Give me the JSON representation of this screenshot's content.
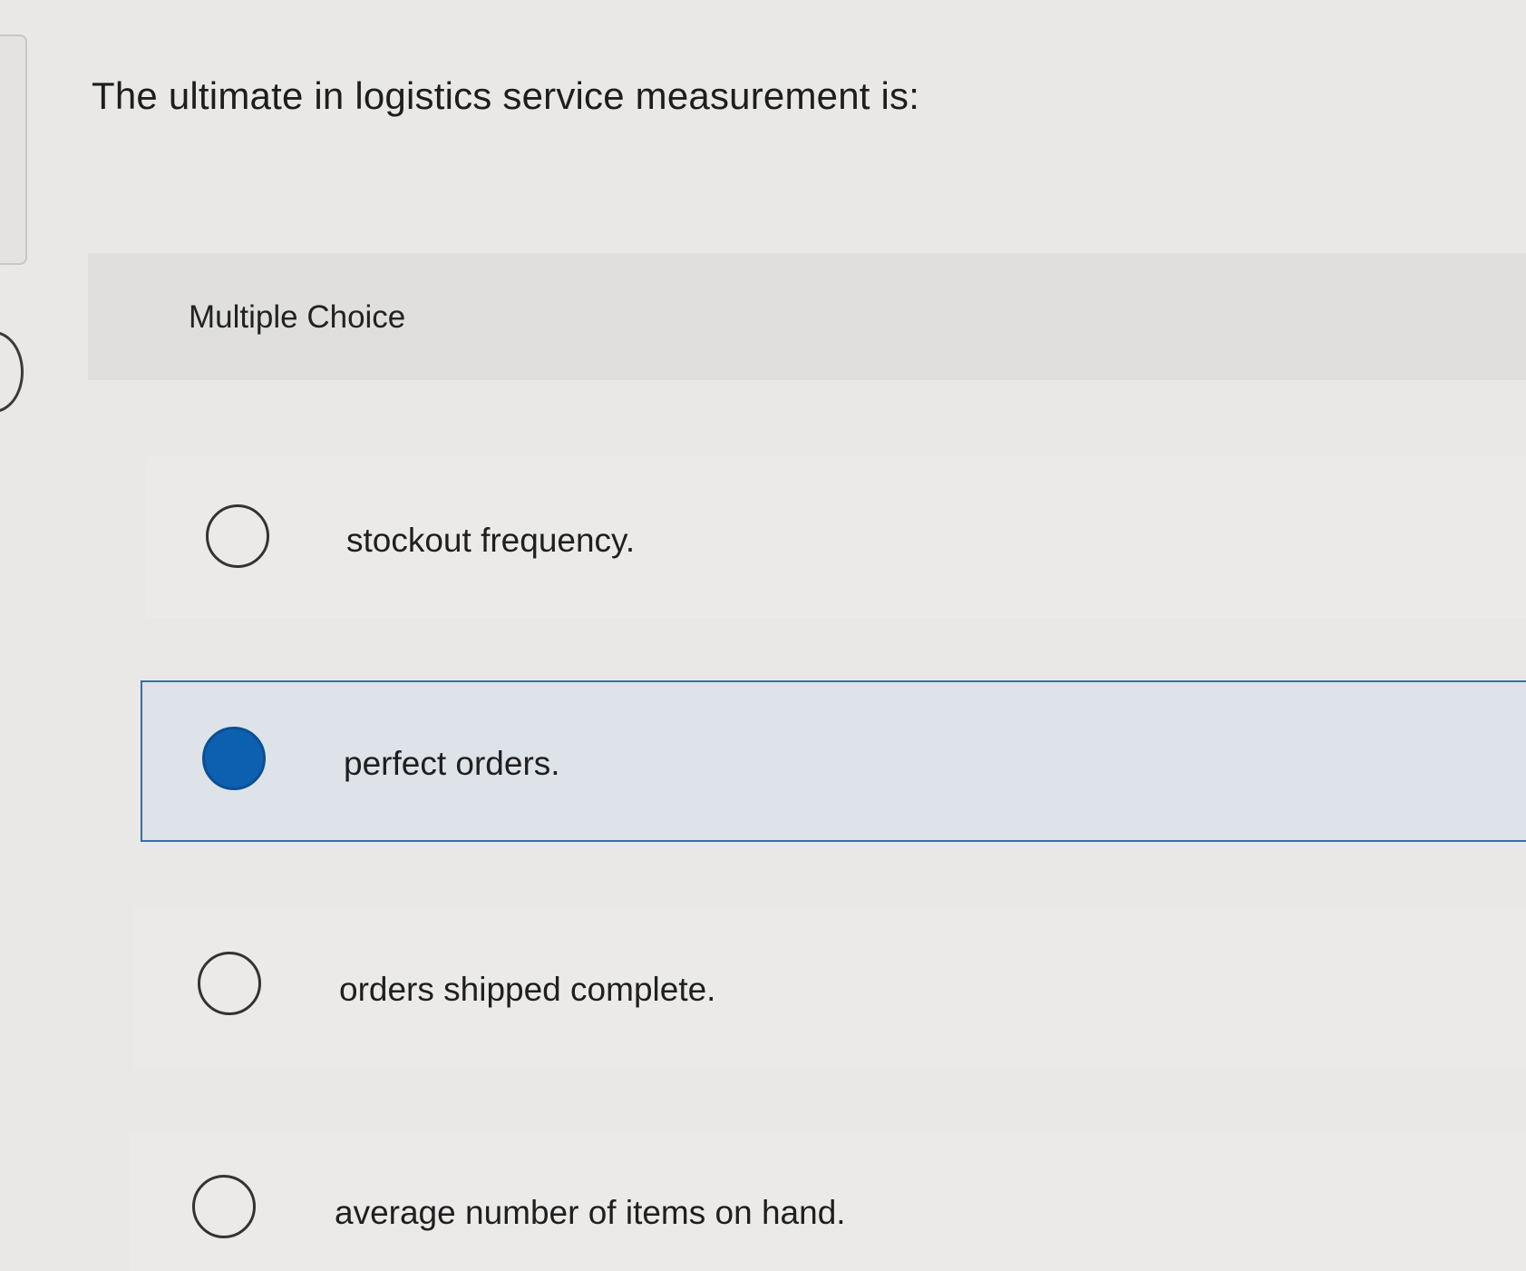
{
  "question": {
    "text": "The ultimate in logistics service measurement is:"
  },
  "question_type": {
    "label": "Multiple Choice"
  },
  "options": [
    {
      "label": "stockout frequency.",
      "selected": false
    },
    {
      "label": "perfect orders.",
      "selected": true
    },
    {
      "label": "orders shipped complete.",
      "selected": false
    },
    {
      "label": "average number of items on hand.",
      "selected": false
    }
  ],
  "colors": {
    "selected_fill": "#0d5fb0",
    "selected_border": "#3c6da3",
    "selected_background": "#dde3e8"
  }
}
